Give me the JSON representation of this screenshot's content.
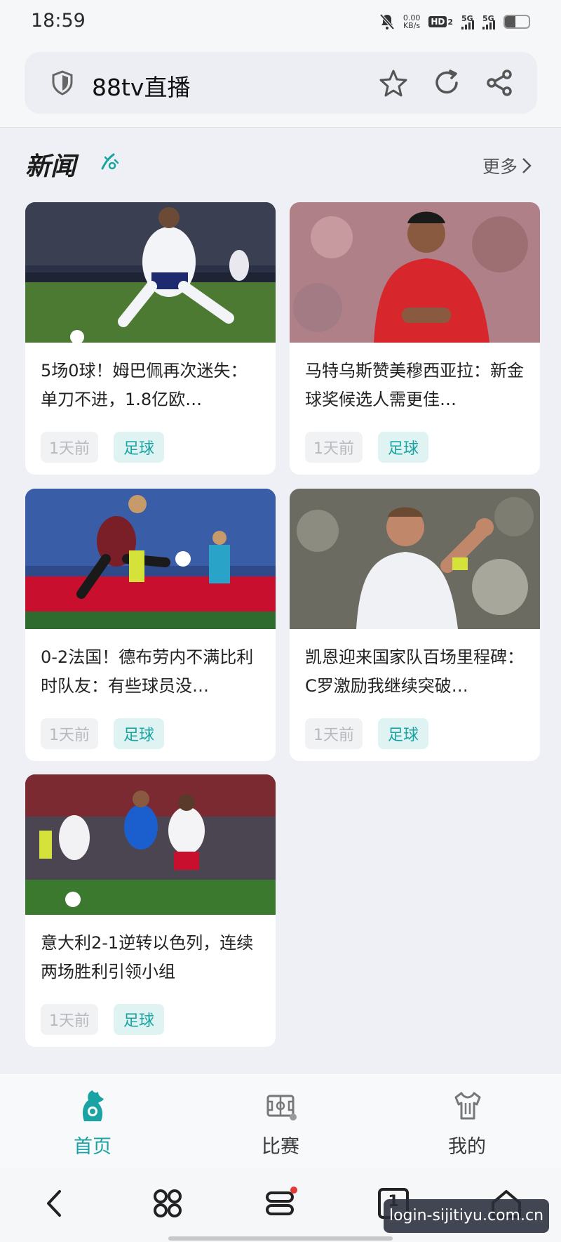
{
  "status_bar": {
    "time": "18:59",
    "net_speed_value": "0.00",
    "net_speed_unit": "KB/s",
    "hd_label": "HD",
    "hd_sub": "2",
    "signal1": "5G",
    "signal2": "5G",
    "battery_level": 0.45
  },
  "browser": {
    "url_text": "88tv直播",
    "icons": [
      "shield-icon",
      "star-icon",
      "refresh-icon",
      "share-icon"
    ]
  },
  "section": {
    "title": "新闻",
    "more_label": "更多"
  },
  "news": [
    {
      "headline": "5场0球！姆巴佩再次迷失：单刀不进，1.8亿欧…",
      "time": "1天前",
      "category": "足球"
    },
    {
      "headline": "马特乌斯赞美穆西亚拉：新金球奖候选人需更佳…",
      "time": "1天前",
      "category": "足球"
    },
    {
      "headline": "0-2法国！德布劳内不满比利时队友：有些球员没…",
      "time": "1天前",
      "category": "足球"
    },
    {
      "headline": "凯恩迎来国家队百场里程碑：C罗激励我继续突破…",
      "time": "1天前",
      "category": "足球"
    },
    {
      "headline": "意大利2-1逆转以色列，连续两场胜利引领小组",
      "time": "1天前",
      "category": "足球"
    }
  ],
  "tabs": [
    {
      "label": "首页",
      "icon": "rooster-icon",
      "active": true
    },
    {
      "label": "比赛",
      "icon": "pitch-icon",
      "active": false
    },
    {
      "label": "我的",
      "icon": "jersey-icon",
      "active": false
    }
  ],
  "system_nav": {
    "tab_count": "1",
    "buttons": [
      "back-icon",
      "apps-icon",
      "menu-icon",
      "tabs-icon",
      "home-icon"
    ]
  },
  "watermark": "login-sijitiyu.com.cn",
  "colors": {
    "accent": "#1aa3a3",
    "page_bg": "#eef0f5",
    "card_bg": "#ffffff",
    "menu_dot": "#e53935"
  }
}
